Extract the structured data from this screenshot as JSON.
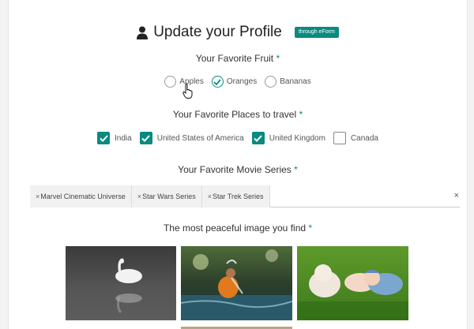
{
  "header": {
    "title": "Update your Profile",
    "badge": "through eForm",
    "icon": "user-icon"
  },
  "fruit": {
    "label": "Your Favorite Fruit",
    "required_mark": "*",
    "options": [
      {
        "label": "Apples",
        "checked": false
      },
      {
        "label": "Oranges",
        "checked": true
      },
      {
        "label": "Bananas",
        "checked": false
      }
    ]
  },
  "places": {
    "label": "Your Favorite Places to travel",
    "required_mark": "*",
    "options": [
      {
        "label": "India",
        "checked": true
      },
      {
        "label": "United States of America",
        "checked": true
      },
      {
        "label": "United Kingdom",
        "checked": true
      },
      {
        "label": "Canada",
        "checked": false
      }
    ]
  },
  "movies": {
    "label": "Your Favorite Movie Series",
    "required_mark": "*",
    "tags": [
      {
        "remove": "×",
        "label": "Marvel Cinematic Universe"
      },
      {
        "remove": "×",
        "label": "Star Wars Series"
      },
      {
        "remove": "×",
        "label": "Star Trek Series"
      }
    ],
    "clear_all": "×"
  },
  "images": {
    "label": "The most peaceful image you find",
    "required_mark": "*",
    "items": [
      "swan-image",
      "child-at-stream-image",
      "sleeping-babies-image"
    ]
  },
  "colors": {
    "accent": "#0a8a80"
  }
}
